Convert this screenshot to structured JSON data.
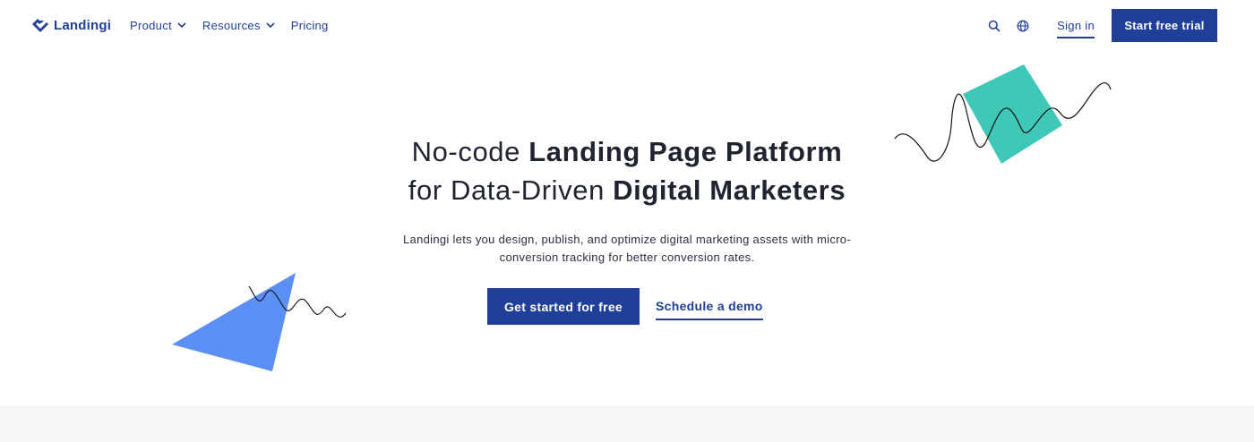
{
  "brand": {
    "name": "Landingi",
    "color": "#1f3f98"
  },
  "nav": {
    "menu": [
      {
        "label": "Product",
        "has_dropdown": true
      },
      {
        "label": "Resources",
        "has_dropdown": true
      },
      {
        "label": "Pricing",
        "has_dropdown": false
      }
    ],
    "search_icon": "search-icon",
    "language_icon": "globe-icon",
    "sign_in": "Sign in",
    "cta": "Start free trial"
  },
  "hero": {
    "title_line1_light": "No-code ",
    "title_line1_bold": "Landing Page Platform",
    "title_line2_light": "for Data-Driven ",
    "title_line2_bold": "Digital Marketers",
    "subtitle": "Landingi lets you design, publish, and optimize digital marketing assets with micro-conversion tracking for better conversion rates.",
    "primary_cta": "Get started for free",
    "secondary_cta": "Schedule a demo"
  },
  "decor": {
    "square_color": "#3fc8b8",
    "triangle_color": "#5b8ff5",
    "wave_color": "#111111"
  },
  "footer_band_color": "#f6f6f6"
}
